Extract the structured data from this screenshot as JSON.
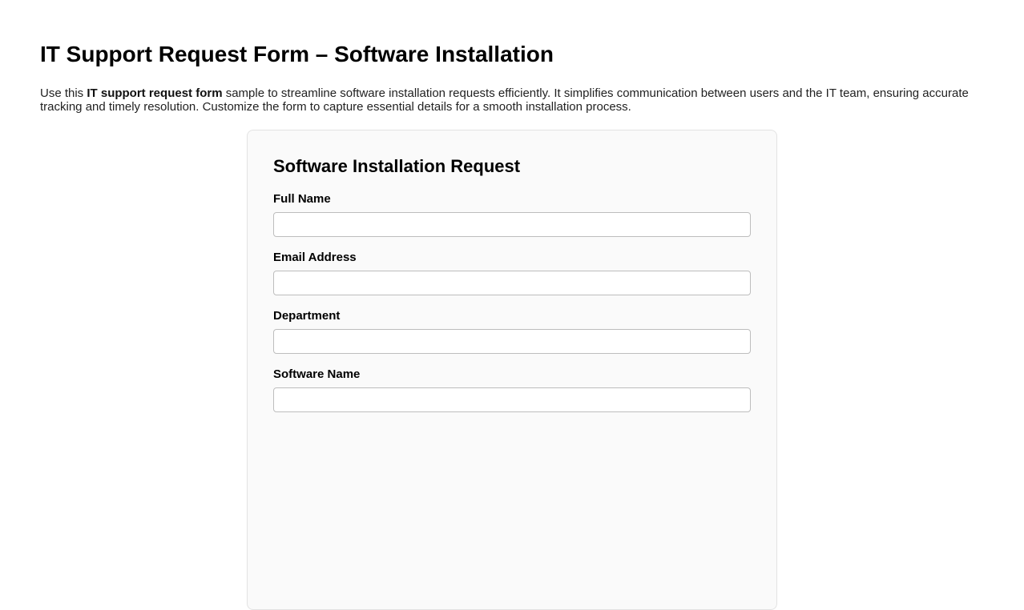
{
  "page": {
    "title": "IT Support Request Form – Software Installation",
    "intro": {
      "text_before_bold": "Use this ",
      "bold_text": "IT support request form",
      "text_after_bold": " sample to streamline software installation requests efficiently. It simplifies communication between users and the IT team, ensuring accurate tracking and timely resolution. Customize the form to capture essential details for a smooth installation process."
    }
  },
  "form": {
    "heading": "Software Installation Request",
    "fields": [
      {
        "label": "Full Name",
        "value": "",
        "placeholder": ""
      },
      {
        "label": "Email Address",
        "value": "",
        "placeholder": ""
      },
      {
        "label": "Department",
        "value": "",
        "placeholder": ""
      },
      {
        "label": "Software Name",
        "value": "",
        "placeholder": ""
      }
    ]
  },
  "colors": {
    "page_background": "#ffffff",
    "card_background": "#fafafa",
    "card_border": "#e3e3e3",
    "input_border": "#bdbdbd",
    "heading_text": "#000000",
    "body_text": "#222222"
  }
}
